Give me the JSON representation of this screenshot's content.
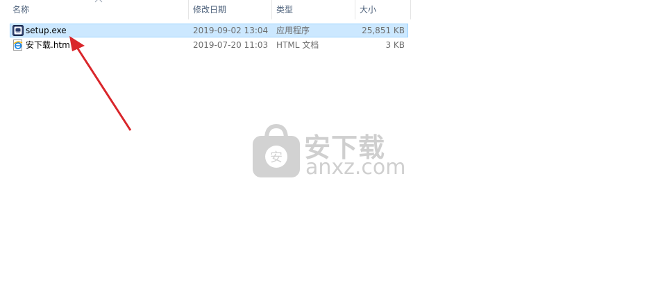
{
  "columns": {
    "name": "名称",
    "date": "修改日期",
    "type": "类型",
    "size": "大小"
  },
  "files": [
    {
      "name": "setup.exe",
      "date": "2019-09-02 13:04",
      "type": "应用程序",
      "size": "25,851 KB",
      "icon": "setup-exe-icon",
      "selected": true
    },
    {
      "name": "安下载.htm",
      "date": "2019-07-20 11:03",
      "type": "HTML 文档",
      "size": "3 KB",
      "icon": "ie-html-icon",
      "selected": false
    }
  ],
  "watermark": {
    "title": "安下载",
    "domain": "anxz.com",
    "badge": "安"
  },
  "colors": {
    "selection_bg": "#cce8ff",
    "selection_border": "#99d1ff",
    "arrow": "#d9262b",
    "watermark": "#cfcfcf"
  }
}
